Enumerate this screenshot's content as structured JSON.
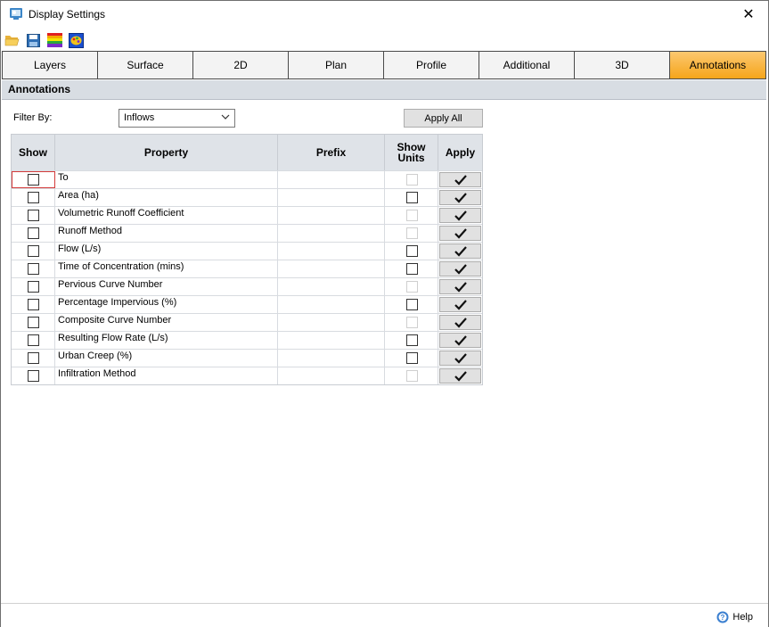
{
  "window": {
    "title": "Display Settings",
    "close_glyph": "✕"
  },
  "toolbar": {
    "buttons": [
      {
        "name": "open-folder-icon"
      },
      {
        "name": "save-icon"
      },
      {
        "name": "color-ramp-icon"
      },
      {
        "name": "palette-icon"
      }
    ]
  },
  "tabs": [
    {
      "label": "Layers",
      "active": false
    },
    {
      "label": "Surface",
      "active": false
    },
    {
      "label": "2D",
      "active": false
    },
    {
      "label": "Plan",
      "active": false
    },
    {
      "label": "Profile",
      "active": false
    },
    {
      "label": "Additional",
      "active": false
    },
    {
      "label": "3D",
      "active": false
    },
    {
      "label": "Annotations",
      "active": true
    }
  ],
  "section": {
    "title": "Annotations"
  },
  "filter": {
    "label": "Filter By:",
    "value": "Inflows"
  },
  "apply_all_label": "Apply All",
  "grid": {
    "headers": {
      "show": "Show",
      "property": "Property",
      "prefix": "Prefix",
      "show_units": "Show Units",
      "apply": "Apply"
    },
    "rows": [
      {
        "property": "To",
        "units_enabled": false
      },
      {
        "property": "Area (ha)",
        "units_enabled": true
      },
      {
        "property": "Volumetric Runoff Coefficient",
        "units_enabled": false
      },
      {
        "property": "Runoff Method",
        "units_enabled": false
      },
      {
        "property": "Flow (L/s)",
        "units_enabled": true
      },
      {
        "property": "Time of Concentration (mins)",
        "units_enabled": true
      },
      {
        "property": "Pervious Curve Number",
        "units_enabled": false
      },
      {
        "property": "Percentage Impervious (%)",
        "units_enabled": true
      },
      {
        "property": "Composite Curve Number",
        "units_enabled": false
      },
      {
        "property": "Resulting Flow Rate (L/s)",
        "units_enabled": true
      },
      {
        "property": "Urban Creep (%)",
        "units_enabled": true
      },
      {
        "property": "Infiltration Method",
        "units_enabled": false
      }
    ]
  },
  "footer": {
    "help_label": "Help"
  },
  "colors": {
    "active_tab": "#f6a51a",
    "header_bg": "#d8dde3",
    "focus": "#d43b3b"
  }
}
